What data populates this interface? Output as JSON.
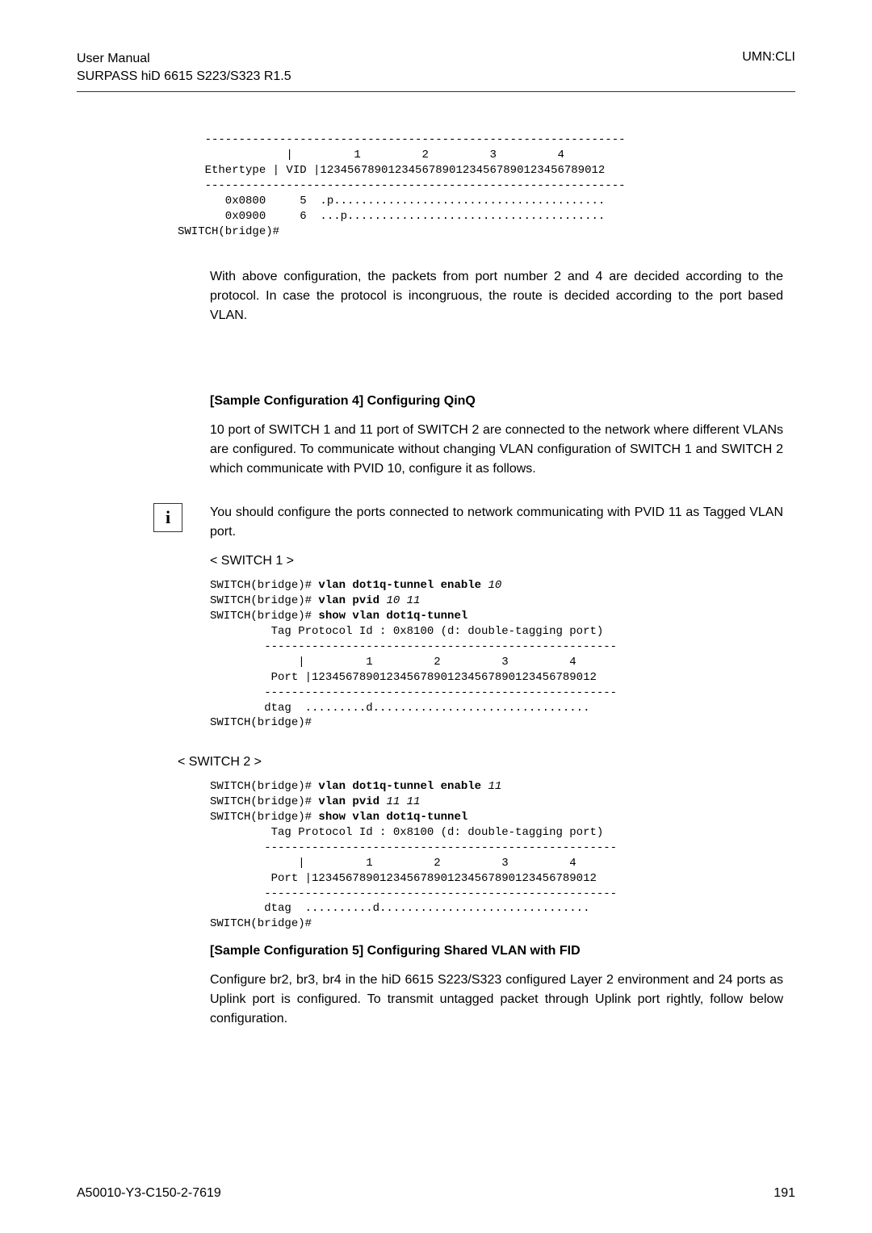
{
  "header": {
    "title_line1": "User Manual",
    "title_line2": "SURPASS hiD 6615 S223/S323 R1.5",
    "right": "UMN:CLI"
  },
  "code1": "    --------------------------------------------------------------\n                |         1         2         3         4\n    Ethertype | VID |123456789012345678901234567890123456789012\n    --------------------------------------------------------------\n       0x0800     5  .p........................................\n       0x0900     6  ...p......................................\nSWITCH(bridge)#",
  "para1": "With above configuration, the packets from port number 2 and 4 are decided according to the protocol. In case the protocol is incongruous, the route is decided according to the port based VLAN.",
  "heading1": "[Sample Configuration 4] Configuring QinQ",
  "para2": "10 port of SWITCH 1 and 11 port of SWITCH 2 are connected to the network where different VLANs are configured. To communicate without changing VLAN configuration of SWITCH 1 and SWITCH 2 which communicate with PVID 10, configure it as follows.",
  "info_icon": "i",
  "info_text": "You should configure the ports connected to network communicating with PVID 11 as Tagged VLAN port.",
  "switch1_label": "< SWITCH 1 >",
  "code2_l1a": "SWITCH(bridge)# ",
  "code2_l1b": "vlan dot1q-tunnel enable",
  "code2_l1c": " 10",
  "code2_l2a": "SWITCH(bridge)# ",
  "code2_l2b": "vlan pvid",
  "code2_l2c": " 10 11",
  "code2_l3a": "SWITCH(bridge)# ",
  "code2_l3b": "show vlan dot1q-tunnel",
  "code2_rest": "         Tag Protocol Id : 0x8100 (d: double-tagging port)\n        ----------------------------------------------------\n             |         1         2         3         4\n         Port |123456789012345678901234567890123456789012\n        ----------------------------------------------------\n        dtag  .........d................................\nSWITCH(bridge)#",
  "switch2_label": "< SWITCH 2 >",
  "code3_l1a": "SWITCH(bridge)# ",
  "code3_l1b": "vlan dot1q-tunnel enable",
  "code3_l1c": " 11",
  "code3_l2a": "SWITCH(bridge)# ",
  "code3_l2b": "vlan pvid",
  "code3_l2c": " 11 11",
  "code3_l3a": "SWITCH(bridge)# ",
  "code3_l3b": "show vlan dot1q-tunnel",
  "code3_rest": "         Tag Protocol Id : 0x8100 (d: double-tagging port)\n        ----------------------------------------------------\n             |         1         2         3         4\n         Port |123456789012345678901234567890123456789012\n        ----------------------------------------------------\n        dtag  ..........d...............................\nSWITCH(bridge)#",
  "heading2": "[Sample Configuration 5] Configuring Shared VLAN with FID",
  "para3": "Configure br2, br3, br4 in the hiD 6615 S223/S323 configured Layer 2 environment and 24 ports as Uplink port is configured. To transmit untagged packet through Uplink port rightly, follow below configuration.",
  "footer_left": "A50010-Y3-C150-2-7619",
  "footer_right": "191"
}
